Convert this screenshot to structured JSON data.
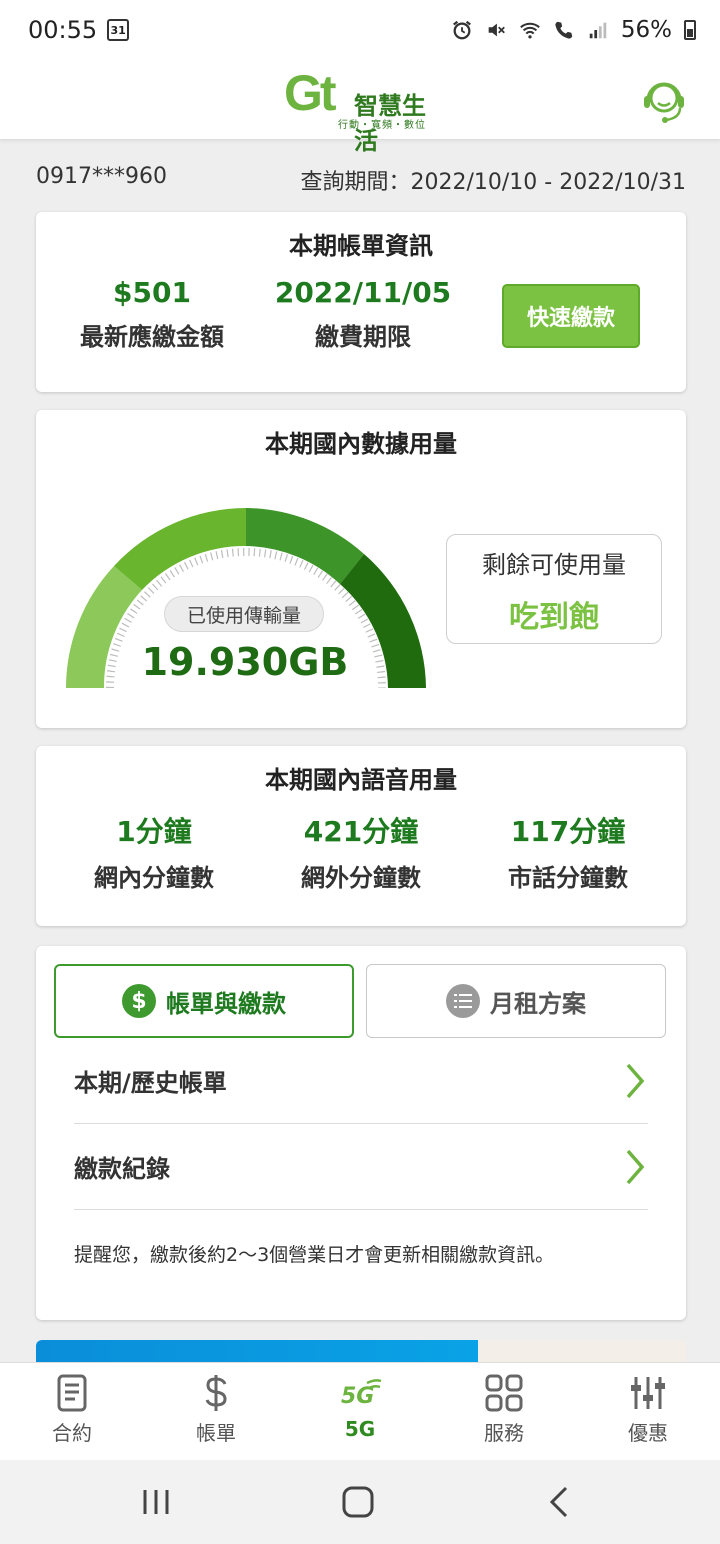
{
  "status_bar": {
    "time": "00:55",
    "calendar_day": "31",
    "battery": "56%",
    "icons": [
      "alarm-icon",
      "mute-icon",
      "wifi-icon",
      "wifi-calling-icon",
      "signal-icon",
      "battery-icon"
    ]
  },
  "header": {
    "logo_mark": "Gt",
    "logo_name": "智慧生活",
    "logo_sub": "行動・寬頻・數位",
    "service_icon": "customer-service-icon"
  },
  "info": {
    "phone": "0917***960",
    "period": "查詢期間：2022/10/10 - 2022/10/31"
  },
  "bill": {
    "title": "本期帳單資訊",
    "amount": "$501",
    "amount_label": "最新應繳金額",
    "due_date": "2022/11/05",
    "due_label": "繳費期限",
    "pay_button": "快速繳款"
  },
  "data_usage": {
    "title": "本期國內數據用量",
    "used_label": "已使用傳輸量",
    "used_value": "19.930GB",
    "remain_label": "剩餘可使用量",
    "remain_value": "吃到飽",
    "gauge_colors": [
      "#8cc85a",
      "#6ab52e",
      "#3d9428",
      "#1f6b0e"
    ]
  },
  "voice_usage": {
    "title": "本期國內語音用量",
    "items": [
      {
        "value": "1分鐘",
        "label": "網內分鐘數"
      },
      {
        "value": "421分鐘",
        "label": "網外分鐘數"
      },
      {
        "value": "117分鐘",
        "label": "市話分鐘數"
      }
    ]
  },
  "tabs": {
    "items": [
      {
        "label": "帳單與繳款",
        "icon": "dollar-icon",
        "active": true
      },
      {
        "label": "月租方案",
        "icon": "list-icon",
        "active": false
      }
    ],
    "rows": [
      "本期/歷史帳單",
      "繳款紀錄"
    ],
    "notice": "提醒您，繳款後約2～3個營業日才會更新相關繳款資訊。"
  },
  "bottom_nav": {
    "items": [
      {
        "label": "合約",
        "icon": "contract-icon"
      },
      {
        "label": "帳單",
        "icon": "dollar-icon"
      },
      {
        "label": "5G",
        "icon": "5g-icon",
        "active": true
      },
      {
        "label": "服務",
        "icon": "services-grid-icon"
      },
      {
        "label": "優惠",
        "icon": "sliders-icon"
      }
    ]
  },
  "colors": {
    "brand_green": "#6db33f",
    "dark_green": "#1e7a1e",
    "pay_button": "#7cc242"
  }
}
